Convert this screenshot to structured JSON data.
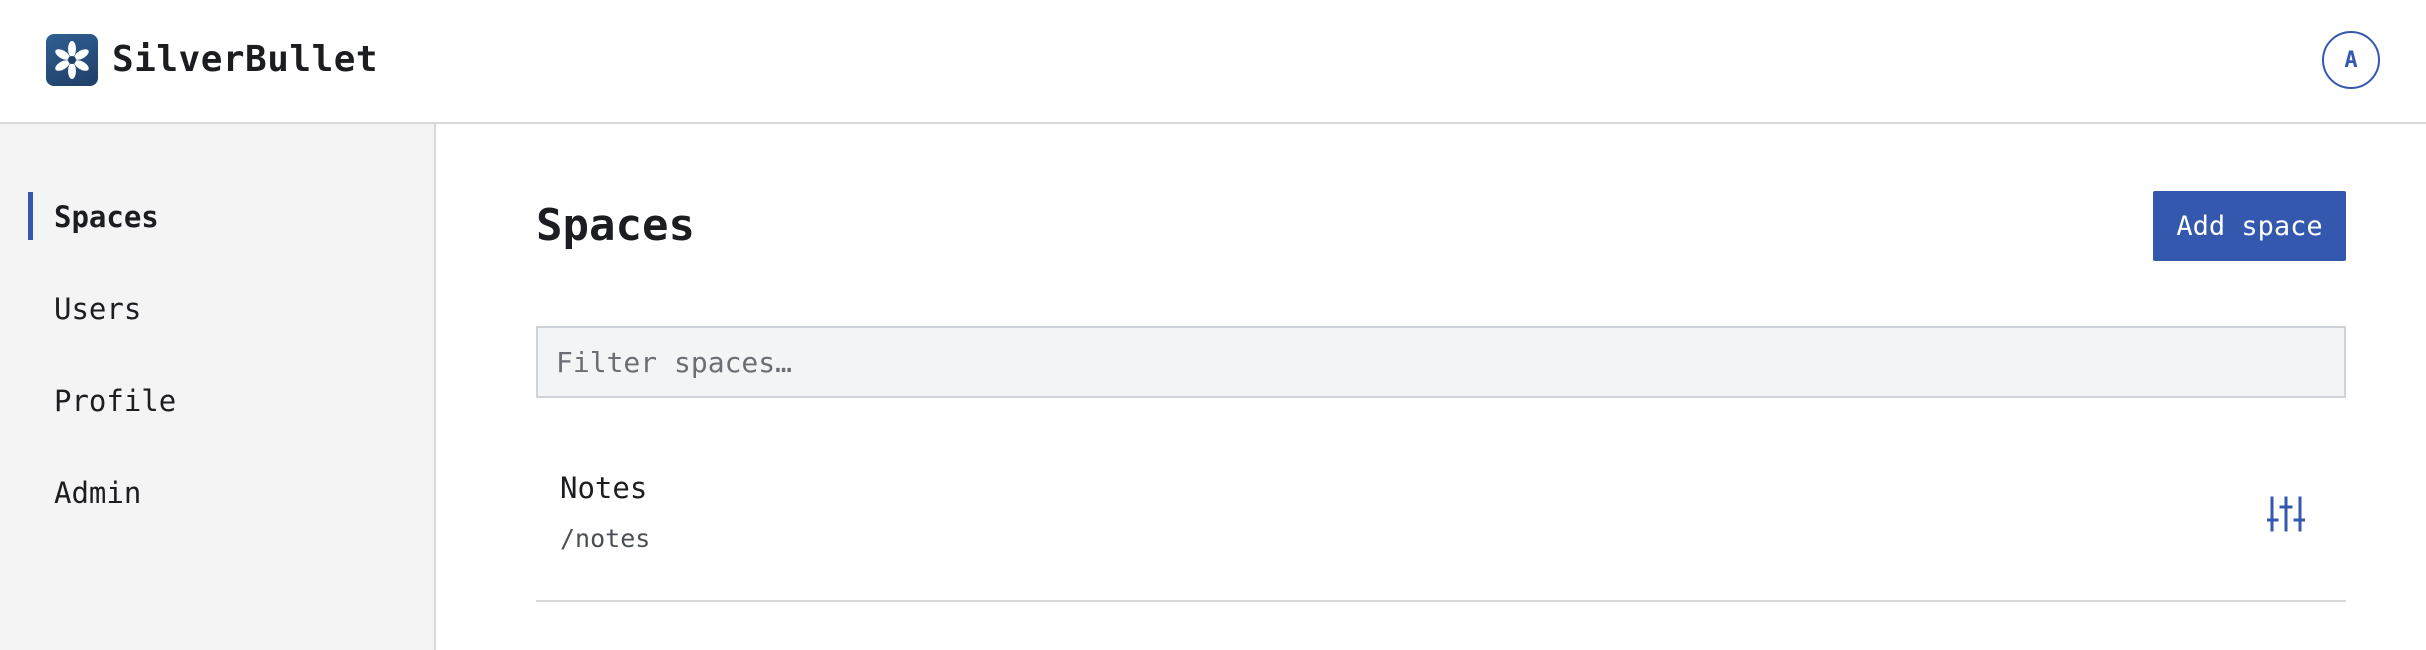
{
  "header": {
    "brand": "SilverBullet",
    "logo_icon": "snowflake-logo-icon",
    "avatar_initial": "A"
  },
  "sidebar": {
    "items": [
      {
        "label": "Spaces",
        "active": true
      },
      {
        "label": "Users",
        "active": false
      },
      {
        "label": "Profile",
        "active": false
      },
      {
        "label": "Admin",
        "active": false
      }
    ]
  },
  "main": {
    "title": "Spaces",
    "add_button_label": "Add space",
    "filter_placeholder": "Filter spaces…",
    "filter_value": "",
    "spaces": [
      {
        "name": "Notes",
        "path": "/notes",
        "action_icon": "sliders-icon"
      }
    ]
  },
  "colors": {
    "accent": "#3358ad",
    "sidebar_bg": "#f4f4f4",
    "border": "#d9d9d9",
    "logo_bg": "#1f3f66"
  }
}
